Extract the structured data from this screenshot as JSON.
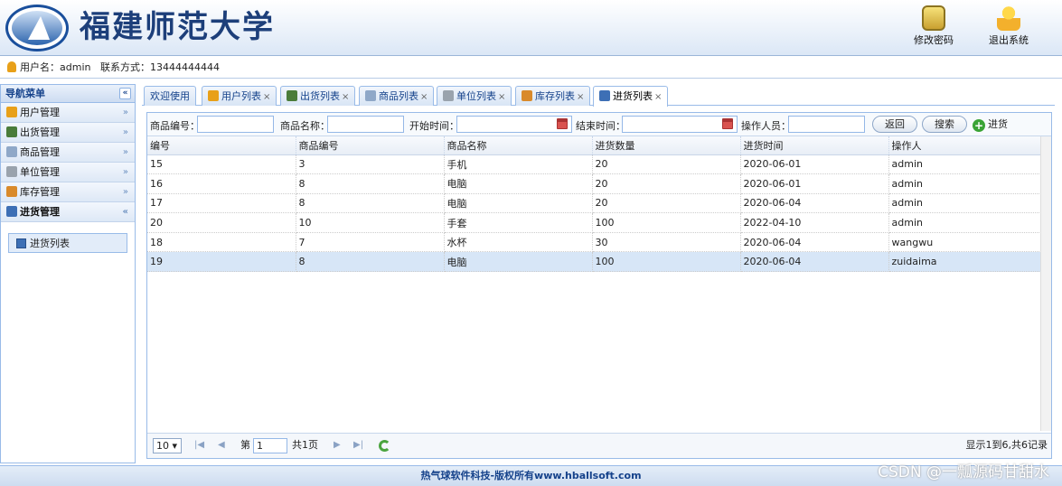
{
  "header": {
    "school_name": "福建师范大学",
    "change_password": "修改密码",
    "logout": "退出系统"
  },
  "userbar": {
    "text": "用户名：admin   联系方式：13444444444"
  },
  "sidebar": {
    "title": "导航菜单",
    "collapse": "«",
    "items": [
      {
        "label": "用户管理",
        "arrow": "»"
      },
      {
        "label": "出货管理",
        "arrow": "»"
      },
      {
        "label": "商品管理",
        "arrow": "»"
      },
      {
        "label": "单位管理",
        "arrow": "»"
      },
      {
        "label": "库存管理",
        "arrow": "»"
      },
      {
        "label": "进货管理",
        "arrow": "«"
      }
    ],
    "sub_item": "进货列表"
  },
  "tabs": [
    {
      "label": "欢迎使用"
    },
    {
      "label": "用户列表"
    },
    {
      "label": "出货列表"
    },
    {
      "label": "商品列表"
    },
    {
      "label": "单位列表"
    },
    {
      "label": "库存列表"
    },
    {
      "label": "进货列表"
    }
  ],
  "tab_close": "×",
  "toolbar": {
    "product_code_label": "商品编号：",
    "product_name_label": "商品名称：",
    "start_time_label": "开始时间：",
    "end_time_label": "结束时间：",
    "operator_label": "操作人员：",
    "back_button": "返回",
    "search_button": "搜索",
    "add_button": "进货"
  },
  "table": {
    "columns": [
      "编号",
      "商品编号",
      "商品名称",
      "进货数量",
      "进货时间",
      "操作人"
    ],
    "rows": [
      [
        "15",
        "3",
        "手机",
        "20",
        "2020-06-01",
        "admin"
      ],
      [
        "16",
        "8",
        "电脑",
        "20",
        "2020-06-01",
        "admin"
      ],
      [
        "17",
        "8",
        "电脑",
        "20",
        "2020-06-04",
        "admin"
      ],
      [
        "20",
        "10",
        "手套",
        "100",
        "2022-04-10",
        "admin"
      ],
      [
        "18",
        "7",
        "水杯",
        "30",
        "2020-06-04",
        "wangwu"
      ],
      [
        "19",
        "8",
        "电脑",
        "100",
        "2020-06-04",
        "zuidaima"
      ]
    ]
  },
  "pager": {
    "page_size": "10",
    "page_prefix": "第",
    "page_value": "1",
    "page_suffix": "共1页",
    "summary": "显示1到6,共6记录"
  },
  "footer": "热气球软件科技-版权所有www.hballsoft.com",
  "watermark": "CSDN @一瓢源码甘甜水"
}
